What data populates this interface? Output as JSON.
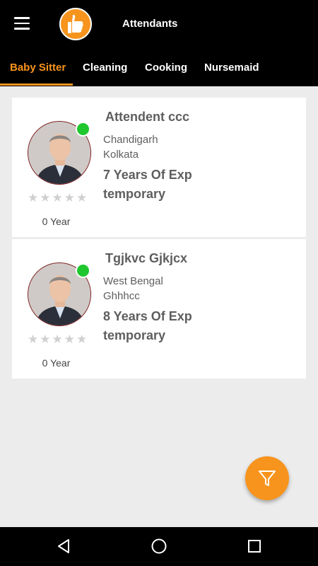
{
  "app": {
    "title": "Attendants"
  },
  "tabs": [
    {
      "label": "Baby Sitter",
      "active": true
    },
    {
      "label": "Cleaning",
      "active": false
    },
    {
      "label": "Cooking",
      "active": false
    },
    {
      "label": "Nursemaid",
      "active": false
    }
  ],
  "attendants": [
    {
      "name": "Attendent ccc",
      "location_line1": "Chandigarh",
      "location_line2": "Kolkata",
      "experience": "7 Years Of Exp",
      "employment": "temporary",
      "rating": 0,
      "rating_max": 5,
      "years_label": "0 Year",
      "online": true
    },
    {
      "name": "Tgjkvc Gjkjcx",
      "location_line1": "West Bengal",
      "location_line2": "Ghhhcc",
      "experience": "8 Years Of Exp",
      "employment": "temporary",
      "rating": 0,
      "rating_max": 5,
      "years_label": "0 Year",
      "online": true
    }
  ],
  "colors": {
    "accent": "#f7941d",
    "online": "#1fc72f",
    "bar": "#000000",
    "background": "#ececec"
  },
  "icons": {
    "menu": "menu-icon",
    "logo": "thumbs-up-icon",
    "filter": "filter-icon",
    "back": "back-triangle-icon",
    "home": "home-circle-icon",
    "recents": "recents-square-icon"
  }
}
